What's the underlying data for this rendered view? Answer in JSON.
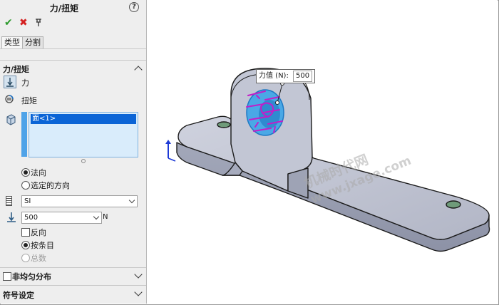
{
  "panel": {
    "title": "力/扭矩",
    "tabs": [
      {
        "label": "类型"
      },
      {
        "label": "分割"
      }
    ],
    "section_force": {
      "title": "力/扭矩",
      "force_label": "力",
      "torque_label": "扭矩",
      "selection": [
        "面<1>"
      ],
      "direction_normal": "法向",
      "direction_selected": "选定的方向",
      "units": "SI",
      "force_value": "500",
      "force_unit": "N",
      "reverse_label": "反向",
      "per_item_label": "按条目",
      "total_label": "总数"
    },
    "section_nonuniform": {
      "title": "非均匀分布"
    },
    "section_symbol": {
      "title": "符号设定"
    }
  },
  "viewport": {
    "callout_label": "力值 (N):",
    "callout_value": "500",
    "watermark_cn": "机械时代网",
    "watermark_url": "www.jxage.com"
  },
  "colors": {
    "part": "#b9bdcc",
    "selection_face": "#4aa8e6",
    "force_arrows": "#c21ec8",
    "accent": "#0a64d6"
  }
}
